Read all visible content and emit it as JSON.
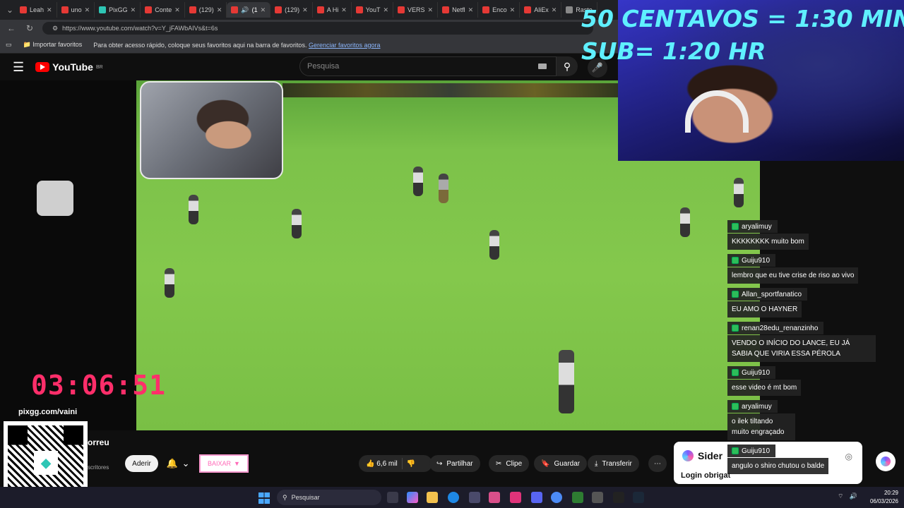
{
  "browser": {
    "tabs": [
      {
        "label": "Leah"
      },
      {
        "label": "uno"
      },
      {
        "label": "PixGG"
      },
      {
        "label": "Conte"
      },
      {
        "label": "(129)"
      },
      {
        "label": "(1"
      },
      {
        "label": "(129)"
      },
      {
        "label": "A Hi"
      },
      {
        "label": "YouT"
      },
      {
        "label": "VERS"
      },
      {
        "label": "Netfl"
      },
      {
        "label": "Enco"
      },
      {
        "label": "AliEx"
      },
      {
        "label": "Raste"
      }
    ],
    "url": "https://www.youtube.com/watch?v=Y_jFAWbAIVs&t=6s",
    "bookmarks": {
      "import_label": "Importar favoritos",
      "hint": "Para obter acesso rápido, coloque seus favoritos aqui na barra de favoritos.",
      "manage_link": "Gerenciar favoritos agora"
    }
  },
  "youtube": {
    "logo_text": "YouTube",
    "region": "BR",
    "search_placeholder": "Pesquisa",
    "title_fragment": "orreu",
    "subs_fragment": "scritores",
    "join_label": "Aderir",
    "download_label": "BAIXAR",
    "actions": {
      "likes": "6,6 mil",
      "share": "Partilhar",
      "clip": "Clipe",
      "save": "Guardar",
      "transfer": "Transferir",
      "more": "⋯"
    }
  },
  "stream_overlay": {
    "price_line1": "50 CENTAVOS = 1:30 MIN",
    "price_line2": "SUB= 1:20 HR",
    "timer": "03:06:51",
    "pix_link": "pixgg.com/vaini"
  },
  "chat": [
    {
      "user": "aryalimuy",
      "text": "KKKKKKKK muito bom"
    },
    {
      "user": "Guiju910",
      "text": "lembro que eu tive crise de riso ao vivo"
    },
    {
      "user": "Allan_sportfanatico",
      "text": "EU AMO O HAYNER"
    },
    {
      "user": "renan28edu_renanzinho",
      "text": "VENDO O INÍCIO DO LANCE, EU JÁ SABIA QUE VIRIA ESSA PÉROLA"
    },
    {
      "user": "Guiju910",
      "text": "esse video é mt bom"
    },
    {
      "user": "aryalimuy",
      "text": "o ilek tiltando muito engraçado"
    },
    {
      "user": "Guiju910",
      "text": "angulo o shiro chutou o balde"
    }
  ],
  "sider": {
    "title": "Sider",
    "login": "Login obrigat"
  },
  "taskbar": {
    "search_label": "Pesquisar",
    "time": "20:29",
    "date": "06/03/2026"
  }
}
